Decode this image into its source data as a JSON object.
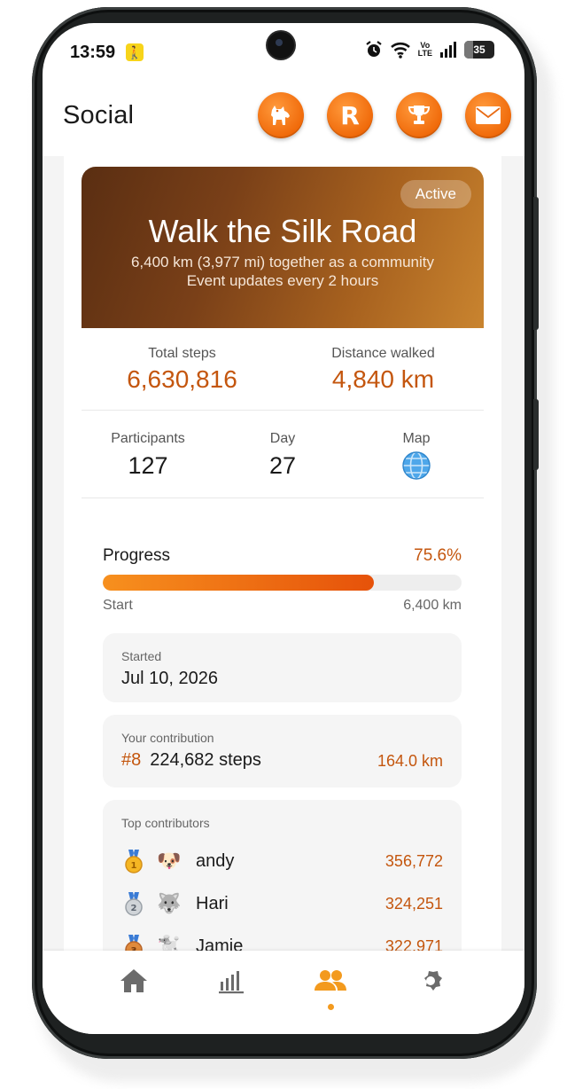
{
  "status_bar": {
    "time": "13:59",
    "walk_icon": "walking-person-icon",
    "battery": "35",
    "volte_top": "Vo",
    "volte_bottom": "LTE"
  },
  "header": {
    "title": "Social",
    "buttons": [
      {
        "name": "dog-icon"
      },
      {
        "name": "rank-r-icon",
        "glyph": "R"
      },
      {
        "name": "trophy-icon"
      },
      {
        "name": "mail-icon"
      }
    ],
    "accent": "#f06a0a"
  },
  "event": {
    "status": "Active",
    "title": "Walk the Silk Road",
    "subtitle_line1": "6,400 km (3,977 mi) together as a community",
    "subtitle_line2": "Event updates every 2 hours",
    "total_steps_label": "Total steps",
    "total_steps": "6,630,816",
    "distance_label": "Distance walked",
    "distance": "4,840 km",
    "participants_label": "Participants",
    "participants": "127",
    "day_label": "Day",
    "day": "27",
    "map_label": "Map",
    "map_icon": "globe-icon"
  },
  "progress": {
    "label": "Progress",
    "percent_text": "75.6%",
    "fraction": 0.756,
    "start_label": "Start",
    "end_label": "6,400 km"
  },
  "started": {
    "caption": "Started",
    "date": "Jul 10, 2026"
  },
  "contribution": {
    "caption": "Your contribution",
    "rank": "#8",
    "steps": "224,682 steps",
    "km": "164.0 km"
  },
  "top_contributors": {
    "caption": "Top contributors",
    "rows": [
      {
        "medal": "gold-medal-icon",
        "avatar": "puppy-avatar-icon",
        "name": "andy",
        "steps": "356,772"
      },
      {
        "medal": "silver-medal-icon",
        "avatar": "wolf-avatar-icon",
        "name": "Hari",
        "steps": "324,251"
      },
      {
        "medal": "bronze-medal-icon",
        "avatar": "white-dog-avatar-icon",
        "name": "Jamie",
        "steps": "322,971"
      }
    ]
  },
  "bottom_nav": {
    "items": [
      {
        "name": "home-icon"
      },
      {
        "name": "stats-icon"
      },
      {
        "name": "social-icon",
        "active": true
      },
      {
        "name": "settings-icon"
      }
    ],
    "active_color": "#f39a1e",
    "inactive_color": "#6b6b6b"
  }
}
